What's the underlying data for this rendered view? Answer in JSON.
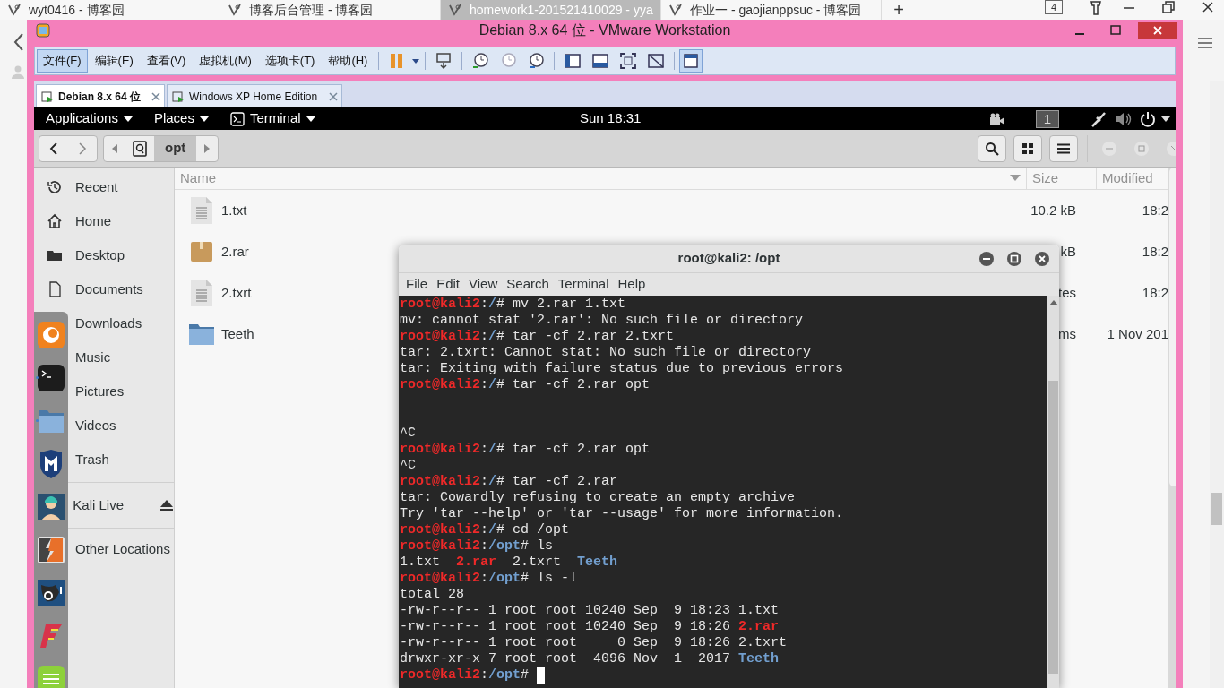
{
  "browser": {
    "tabs": [
      {
        "title": "wyt0416 - 博客园",
        "selected": false
      },
      {
        "title": "博客后台管理 - 博客园",
        "selected": false
      },
      {
        "title": "homework1-201521410029 - yya",
        "selected": true
      },
      {
        "title": "作业一 - gaojianppsuc - 博客园",
        "selected": false
      }
    ],
    "new_tab": "+",
    "tab_count": "4"
  },
  "vmware": {
    "title": "Debian 8.x 64 位 - VMware Workstation",
    "menu": [
      {
        "label": "文件(F)",
        "selected": true
      },
      {
        "label": "编辑(E)",
        "selected": false
      },
      {
        "label": "查看(V)",
        "selected": false
      },
      {
        "label": "虚拟机(M)",
        "selected": false
      },
      {
        "label": "选项卡(T)",
        "selected": false
      },
      {
        "label": "帮助(H)",
        "selected": false
      }
    ],
    "tabs": [
      {
        "label": "Debian 8.x 64 位",
        "selected": true
      },
      {
        "label": "Windows XP Home Edition",
        "selected": false
      }
    ]
  },
  "top_bar": {
    "menus": [
      "Applications",
      "Places",
      "Terminal"
    ],
    "clock": "Sun 18:31",
    "workspace": "1"
  },
  "files": {
    "path": [
      {
        "label": "opt",
        "selected": true
      }
    ],
    "sidebar": [
      {
        "label": "Recent",
        "kind": "recent"
      },
      {
        "label": "Home",
        "kind": "home"
      },
      {
        "label": "Desktop",
        "kind": "desktop"
      },
      {
        "label": "Documents",
        "kind": "documents"
      },
      {
        "label": "Downloads",
        "kind": "hidden"
      },
      {
        "label": "Music",
        "kind": "hidden"
      },
      {
        "label": "Pictures",
        "kind": "hidden"
      },
      {
        "label": "Videos",
        "kind": "hidden"
      },
      {
        "label": "Trash",
        "kind": "hidden"
      },
      {
        "label": "Kali Live",
        "kind": "drive"
      },
      {
        "label": "Other Locations",
        "kind": "other"
      }
    ],
    "columns": [
      "Name",
      "Size",
      "Modified"
    ],
    "rows": [
      {
        "name": "1.txt",
        "kind": "text",
        "size": "10.2 kB",
        "modified": "18:2"
      },
      {
        "name": "2.rar",
        "kind": "archive",
        "size": "kB",
        "modified": "18:2"
      },
      {
        "name": "2.txrt",
        "kind": "text",
        "size": "tes",
        "modified": "18:2"
      },
      {
        "name": "Teeth",
        "kind": "folder",
        "size": "ms",
        "modified": "1 Nov 201"
      }
    ]
  },
  "dock": {
    "apps": [
      {
        "kind": "firefox",
        "running": false
      },
      {
        "kind": "terminal",
        "running": true
      },
      {
        "kind": "files",
        "running": true
      },
      {
        "kind": "shield",
        "running": false
      },
      {
        "kind": "avatar",
        "running": false
      },
      {
        "kind": "bolt",
        "running": false
      },
      {
        "kind": "bull",
        "running": false
      },
      {
        "kind": "flash",
        "running": false
      },
      {
        "kind": "notes",
        "running": false
      }
    ]
  },
  "terminal": {
    "title": "root@kali2: /opt",
    "menu": [
      "File",
      "Edit",
      "View",
      "Search",
      "Terminal",
      "Help"
    ],
    "lines": [
      {
        "kind": "prompt",
        "user": "root@kali2",
        "sep": ":",
        "path": "/",
        "command": "# mv 2.rar 1.txt"
      },
      {
        "kind": "output",
        "text": "mv: cannot stat '2.rar': No such file or directory"
      },
      {
        "kind": "prompt",
        "user": "root@kali2",
        "sep": ":",
        "path": "/",
        "command": "# tar -cf 2.rar 2.txrt"
      },
      {
        "kind": "output",
        "text": "tar: 2.txrt: Cannot stat: No such file or directory"
      },
      {
        "kind": "output",
        "text": "tar: Exiting with failure status due to previous errors"
      },
      {
        "kind": "prompt",
        "user": "root@kali2",
        "sep": ":",
        "path": "/",
        "command": "# tar -cf 2.rar opt"
      },
      {
        "kind": "blank"
      },
      {
        "kind": "blank"
      },
      {
        "kind": "output",
        "text": "^C"
      },
      {
        "kind": "prompt",
        "user": "root@kali2",
        "sep": ":",
        "path": "/",
        "command": "# tar -cf 2.rar opt"
      },
      {
        "kind": "output",
        "text": "^C"
      },
      {
        "kind": "prompt",
        "user": "root@kali2",
        "sep": ":",
        "path": "/",
        "command": "# tar -cf 2.rar"
      },
      {
        "kind": "output",
        "text": "tar: Cowardly refusing to create an empty archive"
      },
      {
        "kind": "output",
        "text": "Try 'tar --help' or 'tar --usage' for more information."
      },
      {
        "kind": "prompt",
        "user": "root@kali2",
        "sep": ":",
        "path": "/",
        "command": "# cd /opt"
      },
      {
        "kind": "prompt",
        "user": "root@kali2",
        "sep": ":",
        "path": "/opt",
        "command": "# ls"
      },
      {
        "kind": "files",
        "items": [
          {
            "name": "1.txt",
            "kind": "file"
          },
          {
            "name": "2.rar",
            "kind": "archive"
          },
          {
            "name": "2.txrt",
            "kind": "file"
          },
          {
            "name": "Teeth",
            "kind": "dir"
          }
        ]
      },
      {
        "kind": "prompt",
        "user": "root@kali2",
        "sep": ":",
        "path": "/opt",
        "command": "# ls -l"
      },
      {
        "kind": "output",
        "text": "total 28"
      },
      {
        "kind": "listing",
        "info": "-rw-r--r-- 1 root root 10240 Sep  9 18:23 ",
        "file": {
          "name": "1.txt",
          "kind": "file"
        }
      },
      {
        "kind": "listing",
        "info": "-rw-r--r-- 1 root root 10240 Sep  9 18:26 ",
        "file": {
          "name": "2.rar",
          "kind": "archive"
        }
      },
      {
        "kind": "listing",
        "info": "-rw-r--r-- 1 root root     0 Sep  9 18:26 ",
        "file": {
          "name": "2.txrt",
          "kind": "file"
        }
      },
      {
        "kind": "listing",
        "info": "drwxr-xr-x 7 root root  4096 Nov  1  2017 ",
        "file": {
          "name": "Teeth",
          "kind": "dir"
        }
      },
      {
        "kind": "prompt",
        "user": "root@kali2",
        "sep": ":",
        "path": "/opt",
        "command": "#",
        "cursor": true
      }
    ]
  }
}
